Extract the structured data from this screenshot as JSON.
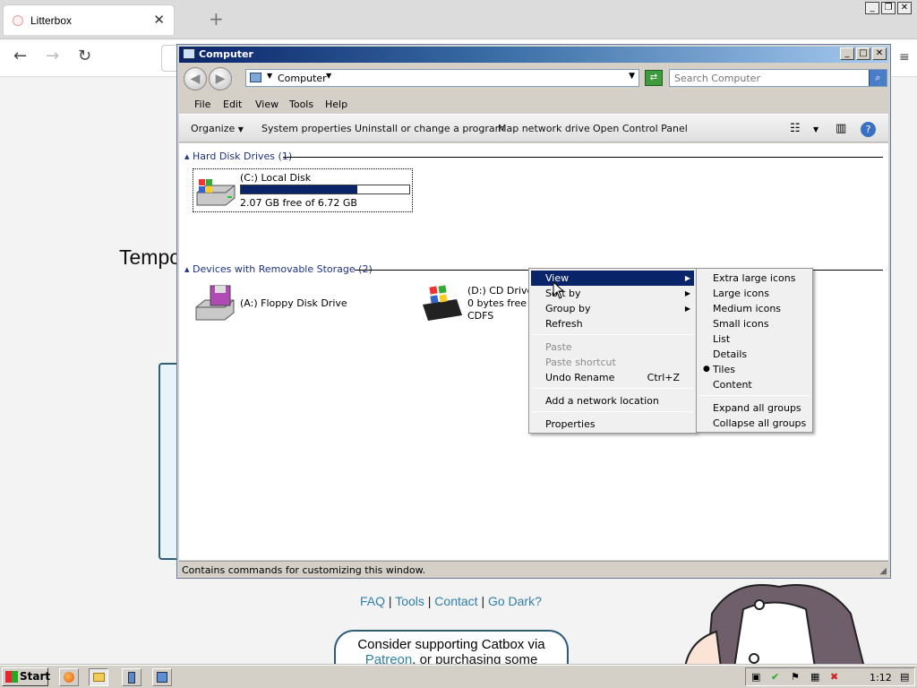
{
  "browser": {
    "tab_title": "Litterbox",
    "tab_close": "✕",
    "new_tab": "+",
    "window_buttons": [
      "_",
      "❐",
      "✕"
    ],
    "nav": {
      "back": "←",
      "forward": "→",
      "reload": "↻",
      "menu": "≡"
    }
  },
  "webpage": {
    "heading_partial": "Tempo",
    "links": [
      "FAQ",
      "Tools",
      "Contact",
      "Go Dark?"
    ],
    "link_separator": "|",
    "support_line1": "Consider supporting Catbox via",
    "support_link": "Patreon",
    "support_line2_rest": ", or purchasing some"
  },
  "explorer": {
    "title": "Computer",
    "controls": [
      "_",
      "□",
      "✕"
    ],
    "address": {
      "path": "Computer",
      "search_placeholder": "Search Computer"
    },
    "menubar": [
      "File",
      "Edit",
      "View",
      "Tools",
      "Help"
    ],
    "toolbar": [
      "Organize",
      "System properties",
      "Uninstall or change a program",
      "Map network drive",
      "Open Control Panel"
    ],
    "groups": [
      {
        "label": "Hard Disk Drives (1)"
      },
      {
        "label": "Devices with Removable Storage (2)"
      }
    ],
    "drives": {
      "c": {
        "name": "(C:) Local Disk",
        "free_text": "2.07 GB free of 6.72 GB",
        "used_fraction": 0.69
      },
      "a": {
        "name": "(A:) Floppy Disk Drive"
      },
      "d": {
        "name": "(D:) CD Drive - HFSLIPCD",
        "free_text": "0 bytes free of 524 MB",
        "fs": "CDFS"
      }
    },
    "status_text": "Contains commands for customizing this window."
  },
  "context_menu": {
    "items": [
      {
        "label": "View",
        "submenu": true,
        "highlighted": true
      },
      {
        "label": "Sort by",
        "submenu": true
      },
      {
        "label": "Group by",
        "submenu": true
      },
      {
        "label": "Refresh"
      },
      {
        "label": "Paste",
        "disabled": true
      },
      {
        "label": "Paste shortcut",
        "disabled": true
      },
      {
        "label": "Undo Rename",
        "shortcut": "Ctrl+Z"
      },
      {
        "label": "Add a network location"
      },
      {
        "label": "Properties"
      }
    ]
  },
  "view_submenu": {
    "items": [
      "Extra large icons",
      "Large icons",
      "Medium icons",
      "Small icons",
      "List",
      "Details",
      "Tiles",
      "Content",
      "Expand all groups",
      "Collapse all groups"
    ],
    "selected": "Tiles"
  },
  "taskbar": {
    "start_label": "Start",
    "clock": "1:12"
  }
}
